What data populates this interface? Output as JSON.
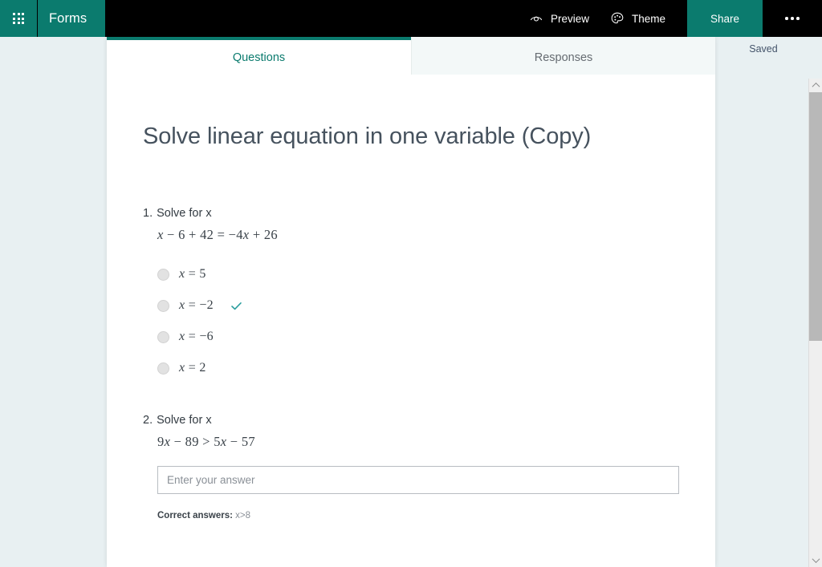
{
  "header": {
    "waffle_icon": "app-launcher-grid-icon",
    "brand": "Forms",
    "preview": {
      "label": "Preview",
      "icon": "eye-icon"
    },
    "theme": {
      "label": "Theme",
      "icon": "palette-icon"
    },
    "share": {
      "label": "Share"
    },
    "more": {
      "icon": "ellipsis-icon"
    },
    "bg_color": "#000000",
    "accent_color": "#0b7b6e"
  },
  "status": {
    "saved_label": "Saved"
  },
  "tabs": [
    {
      "label": "Questions",
      "active": true
    },
    {
      "label": "Responses",
      "active": false
    }
  ],
  "form": {
    "title": "Solve linear equation in one variable (Copy)",
    "questions": [
      {
        "number": "1.",
        "prompt": "Solve for x",
        "equation_parts": [
          {
            "t": "x",
            "italic": true
          },
          {
            "t": " − 6 + 42 = −4",
            "italic": false
          },
          {
            "t": "x",
            "italic": true
          },
          {
            "t": " + 26",
            "italic": false
          }
        ],
        "type": "choice",
        "options": [
          {
            "parts": [
              {
                "t": "x",
                "italic": true
              },
              {
                "t": " = 5",
                "italic": false
              }
            ],
            "correct": false
          },
          {
            "parts": [
              {
                "t": "x",
                "italic": true
              },
              {
                "t": " = −2",
                "italic": false
              }
            ],
            "correct": true
          },
          {
            "parts": [
              {
                "t": "x",
                "italic": true
              },
              {
                "t": " = −6",
                "italic": false
              }
            ],
            "correct": false
          },
          {
            "parts": [
              {
                "t": "x",
                "italic": true
              },
              {
                "t": " = 2",
                "italic": false
              }
            ],
            "correct": false
          }
        ]
      },
      {
        "number": "2.",
        "prompt": "Solve for x",
        "equation_parts": [
          {
            "t": "9",
            "italic": false
          },
          {
            "t": "x",
            "italic": true
          },
          {
            "t": " − 89 > 5",
            "italic": false
          },
          {
            "t": "x",
            "italic": true
          },
          {
            "t": " − 57",
            "italic": false
          }
        ],
        "type": "text",
        "input_placeholder": "Enter your answer",
        "input_value": "",
        "correct_answers_label": "Correct answers:",
        "correct_answers_value": "x>8"
      }
    ]
  },
  "scrollbar": {
    "up_icon": "chevron-up-icon",
    "down_icon": "chevron-down-icon"
  },
  "colors": {
    "page_bg": "#e8f0f2",
    "teal": "#0b7b6e",
    "check_teal": "#2b9e9e"
  }
}
